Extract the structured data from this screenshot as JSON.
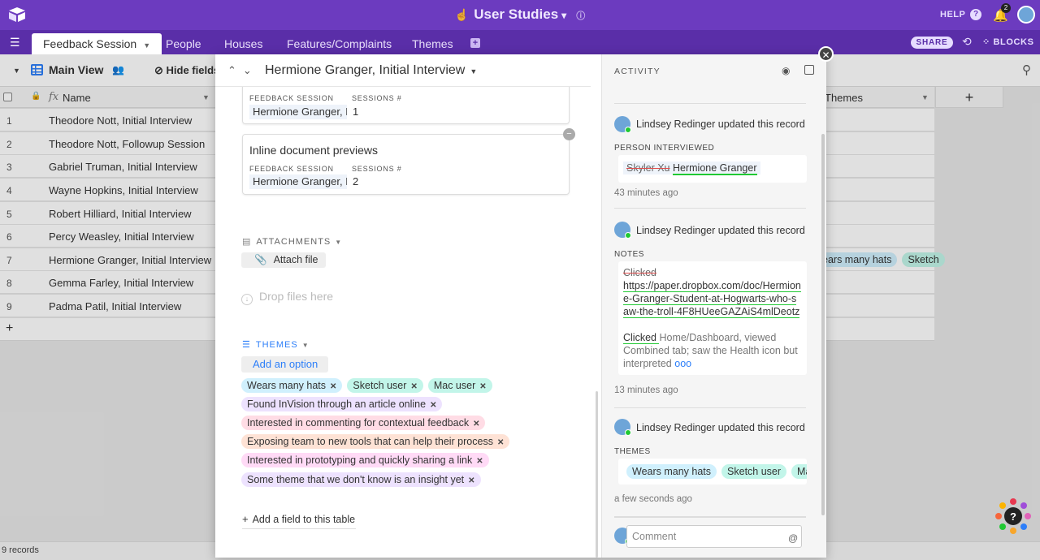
{
  "app": {
    "title": "User Studies",
    "help": "HELP",
    "notifications": "2",
    "share": "SHARE",
    "blocks": "BLOCKS"
  },
  "tabs": [
    {
      "label": "Feedback Session",
      "active": true
    },
    {
      "label": "People"
    },
    {
      "label": "Houses"
    },
    {
      "label": "Features/Complaints"
    },
    {
      "label": "Themes"
    }
  ],
  "view": {
    "name": "Main View",
    "hide_fields": "Hide fields"
  },
  "grid": {
    "name_header": "Name",
    "themes_header": "Themes",
    "rows": [
      {
        "n": "1",
        "name": "Theodore Nott, Initial Interview"
      },
      {
        "n": "2",
        "name": "Theodore Nott, Followup Session"
      },
      {
        "n": "3",
        "name": "Gabriel Truman, Initial Interview"
      },
      {
        "n": "4",
        "name": "Wayne Hopkins, Initial Interview"
      },
      {
        "n": "5",
        "name": "Robert Hilliard, Initial Interview"
      },
      {
        "n": "6",
        "name": "Percy Weasley, Initial Interview"
      },
      {
        "n": "7",
        "name": "Hermione Granger, Initial Interview",
        "tags": [
          "ears many hats",
          "Sketch"
        ]
      },
      {
        "n": "8",
        "name": "Gemma Farley, Initial Interview"
      },
      {
        "n": "9",
        "name": "Padma Patil, Initial Interview"
      }
    ],
    "record_count": "9 records"
  },
  "record": {
    "title": "Hermione Granger, Initial Interview",
    "cards": [
      {
        "feedback_label": "FEEDBACK SESSION",
        "feedback_value": "Hermione Granger, In",
        "sessions_label": "SESSIONS #",
        "sessions_value": "1"
      },
      {
        "title": "Inline document previews",
        "feedback_label": "FEEDBACK SESSION",
        "feedback_value": "Hermione Granger, In",
        "sessions_label": "SESSIONS #",
        "sessions_value": "2"
      }
    ],
    "attachments_label": "ATTACHMENTS",
    "attach_file": "Attach file",
    "drop_files": "Drop files here",
    "themes_label": "THEMES",
    "add_option": "Add an option",
    "themes": [
      {
        "label": "Wears many hats",
        "color": "#d0f0fd"
      },
      {
        "label": "Sketch user",
        "color": "#c2f5e9"
      },
      {
        "label": "Mac user",
        "color": "#c2f5e9"
      },
      {
        "label": "Found InVision through an article online",
        "color": "#ede2fe"
      },
      {
        "label": "Interested in commenting for contextual feedback",
        "color": "#ffdce5"
      },
      {
        "label": "Exposing team to new tools that can help their process",
        "color": "#fee2d5"
      },
      {
        "label": "Interested in prototyping and quickly sharing a link",
        "color": "#ffdaf6"
      },
      {
        "label": "Some theme that we don't know is an insight yet",
        "color": "#ede2fe"
      }
    ],
    "add_field": "Add a field to this table"
  },
  "activity": {
    "title": "ACTIVITY",
    "entries": [
      {
        "user": "Lindsey Redinger updated this record",
        "field": "PERSON INTERVIEWED",
        "removed": "Skyler Xu",
        "added": "Hermione Granger",
        "time": "43 minutes ago"
      },
      {
        "user": "Lindsey Redinger updated this record",
        "field": "NOTES",
        "removed": "Clicked ",
        "added_url": "https://paper.dropbox.com/doc/Hermione-Granger-Student-at-Hogwarts-who-saw-the-troll-4F8HUeeGAZAiS4mlDeotz",
        "added_word": "Clicked ",
        "rest": "Home/Dashboard, viewed Combined tab; saw the Health icon but interpreted",
        "more": "ooo",
        "time": "13 minutes ago"
      },
      {
        "user": "Lindsey Redinger updated this record",
        "field": "THEMES",
        "chips": [
          "Wears many hats",
          "Sketch user",
          "Mac"
        ],
        "time": "a few seconds ago"
      }
    ],
    "comment_placeholder": "Comment",
    "comment_at": "@"
  },
  "colors": {
    "brand": "#6c3bbf",
    "tab_bar": "#5a2ea8",
    "accent": "#2d7ff9"
  }
}
